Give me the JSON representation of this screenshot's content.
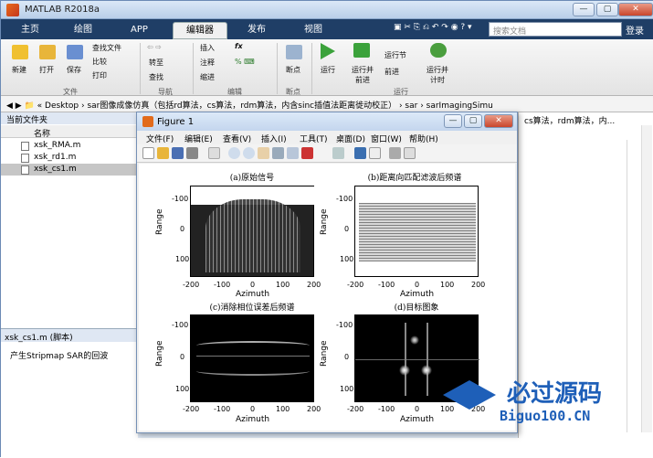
{
  "app": {
    "title": "MATLAB R2018a",
    "minimize": "—",
    "maximize": "▢",
    "close": "✕"
  },
  "tabs": [
    "主页",
    "绘图",
    "APP",
    "编辑器",
    "发布",
    "视图"
  ],
  "search": {
    "placeholder": "搜索文档"
  },
  "login": "登录",
  "toolstrip": {
    "file_group": "文件",
    "nav_group": "导航",
    "edit_group": "编辑",
    "bp_group": "断点",
    "run_group": "运行",
    "new": "新建",
    "open": "打开",
    "save": "保存",
    "find_files": "查找文件",
    "compare": "比较",
    "print": "打印",
    "goto": "转至",
    "find": "查找",
    "insert": "插入",
    "comment": "注释",
    "indent": "缩进",
    "fx": "fx",
    "breakpoints": "断点",
    "run": "运行",
    "run_advance": "运行并\n前进",
    "run_section": "运行节",
    "advance": "前进",
    "run_time": "运行并\n计时"
  },
  "address": "« Desktop › sar图像成像仿真（包括rd算法，cs算法，rdm算法，内含sinc插值法距离徙动校正） › sar › sarImagingSimu",
  "current_folder": {
    "title": "当前文件夹",
    "name_col": "名称",
    "files": [
      "xsk_RMA.m",
      "xsk_rd1.m",
      "xsk_cs1.m"
    ]
  },
  "details": {
    "title": "xsk_cs1.m  (脚本)",
    "text": "产生Stripmap SAR的回波"
  },
  "editor_snippet": "cs算法，rdm算法，内...",
  "figure": {
    "title": "Figure 1",
    "menus": [
      "文件(F)",
      "编辑(E)",
      "查看(V)",
      "插入(I)",
      "工具(T)",
      "桌面(D)",
      "窗口(W)",
      "帮助(H)"
    ],
    "subplots": [
      {
        "title": "(a)原始信号",
        "xlabel": "Azimuth",
        "ylabel": "Range",
        "xticks": [
          "-200",
          "-100",
          "0",
          "100",
          "200"
        ],
        "yticks": [
          "-100",
          "0",
          "100"
        ]
      },
      {
        "title": "(b)距离向匹配滤波后频谱",
        "xlabel": "Azimuth",
        "ylabel": "Range",
        "xticks": [
          "-200",
          "-100",
          "0",
          "100",
          "200"
        ],
        "yticks": [
          "-100",
          "0",
          "100"
        ]
      },
      {
        "title": "(c)消除相位误差后频谱",
        "xlabel": "Azimuth",
        "ylabel": "Range",
        "xticks": [
          "-200",
          "-100",
          "0",
          "100",
          "200"
        ],
        "yticks": [
          "-100",
          "0",
          "100"
        ]
      },
      {
        "title": "(d)目标图象",
        "xlabel": "Azimuth",
        "ylabel": "Range",
        "xticks": [
          "-200",
          "-100",
          "0",
          "100",
          "200"
        ],
        "yticks": [
          "-100",
          "0",
          "100"
        ]
      }
    ]
  },
  "watermark": {
    "cn": "必过源码",
    "url": "Biguo100.CN"
  }
}
